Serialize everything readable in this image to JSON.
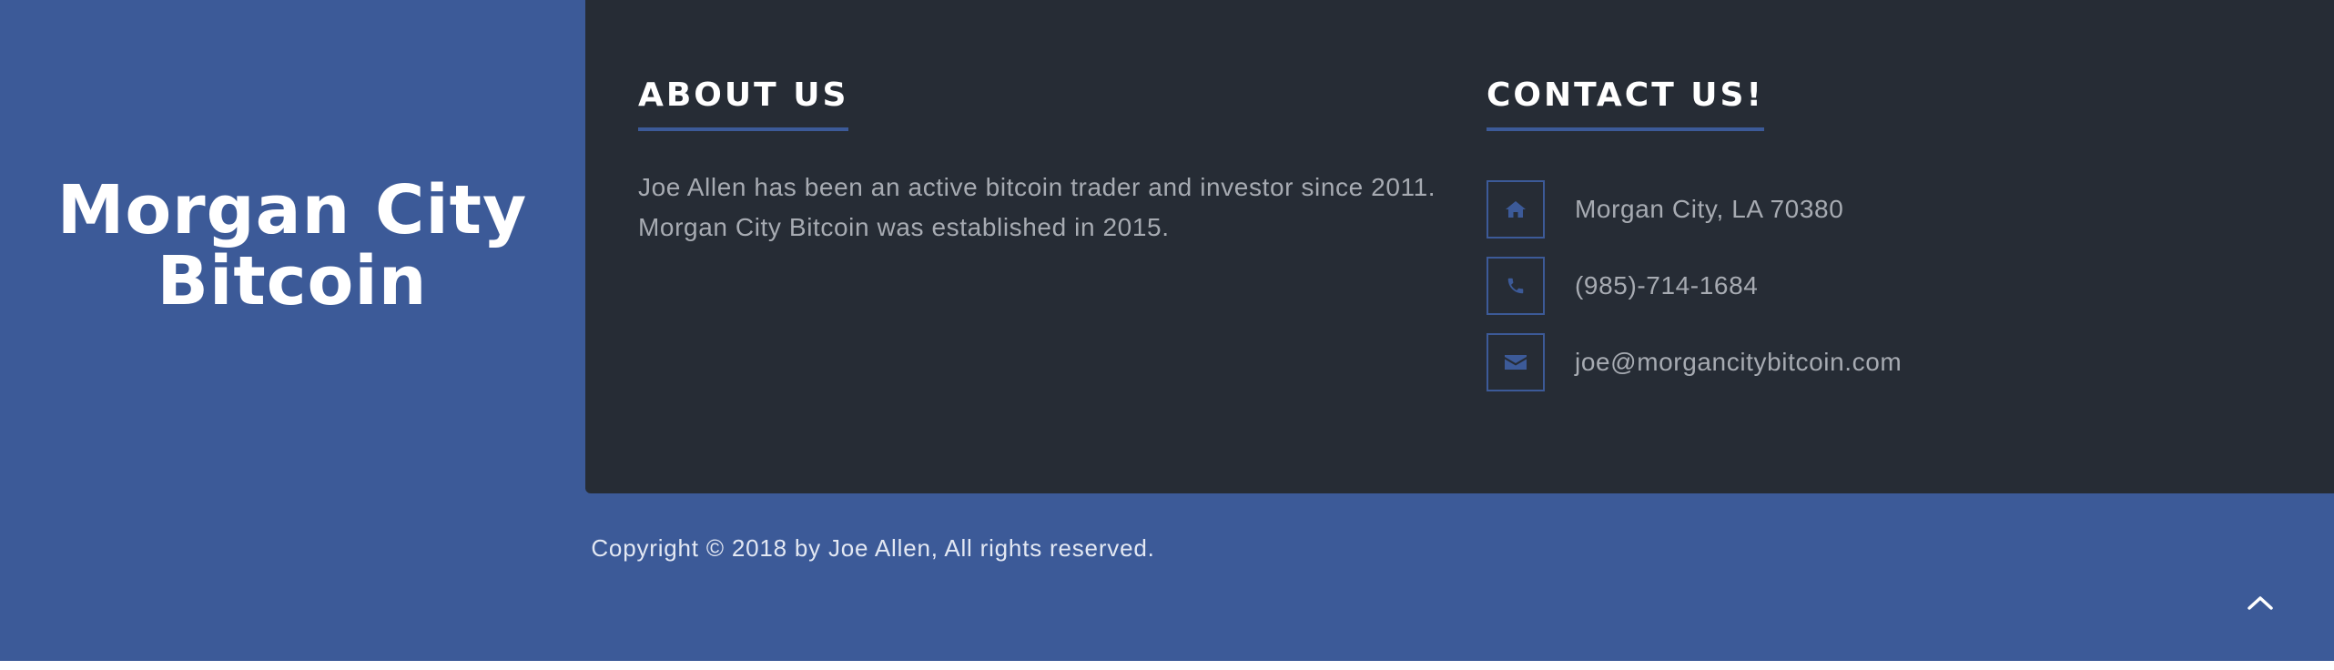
{
  "brand": {
    "title": "Morgan City Bitcoin"
  },
  "about": {
    "heading": "ABOUT US",
    "line1": "Joe Allen has been an active bitcoin trader and investor since 2011.",
    "line2": "Morgan City Bitcoin was established in 2015."
  },
  "contact": {
    "heading": "CONTACT US!",
    "items": [
      {
        "icon": "home-icon",
        "text": "Morgan City, LA 70380"
      },
      {
        "icon": "phone-icon",
        "text": "(985)-714-1684"
      },
      {
        "icon": "envelope-icon",
        "text": "joe@morgancitybitcoin.com"
      }
    ]
  },
  "footer": {
    "copyright": "Copyright © 2018 by Joe Allen, All rights reserved."
  },
  "colors": {
    "accent": "#3c5a98",
    "panel": "#262c35",
    "text_muted": "#a7abb2"
  }
}
